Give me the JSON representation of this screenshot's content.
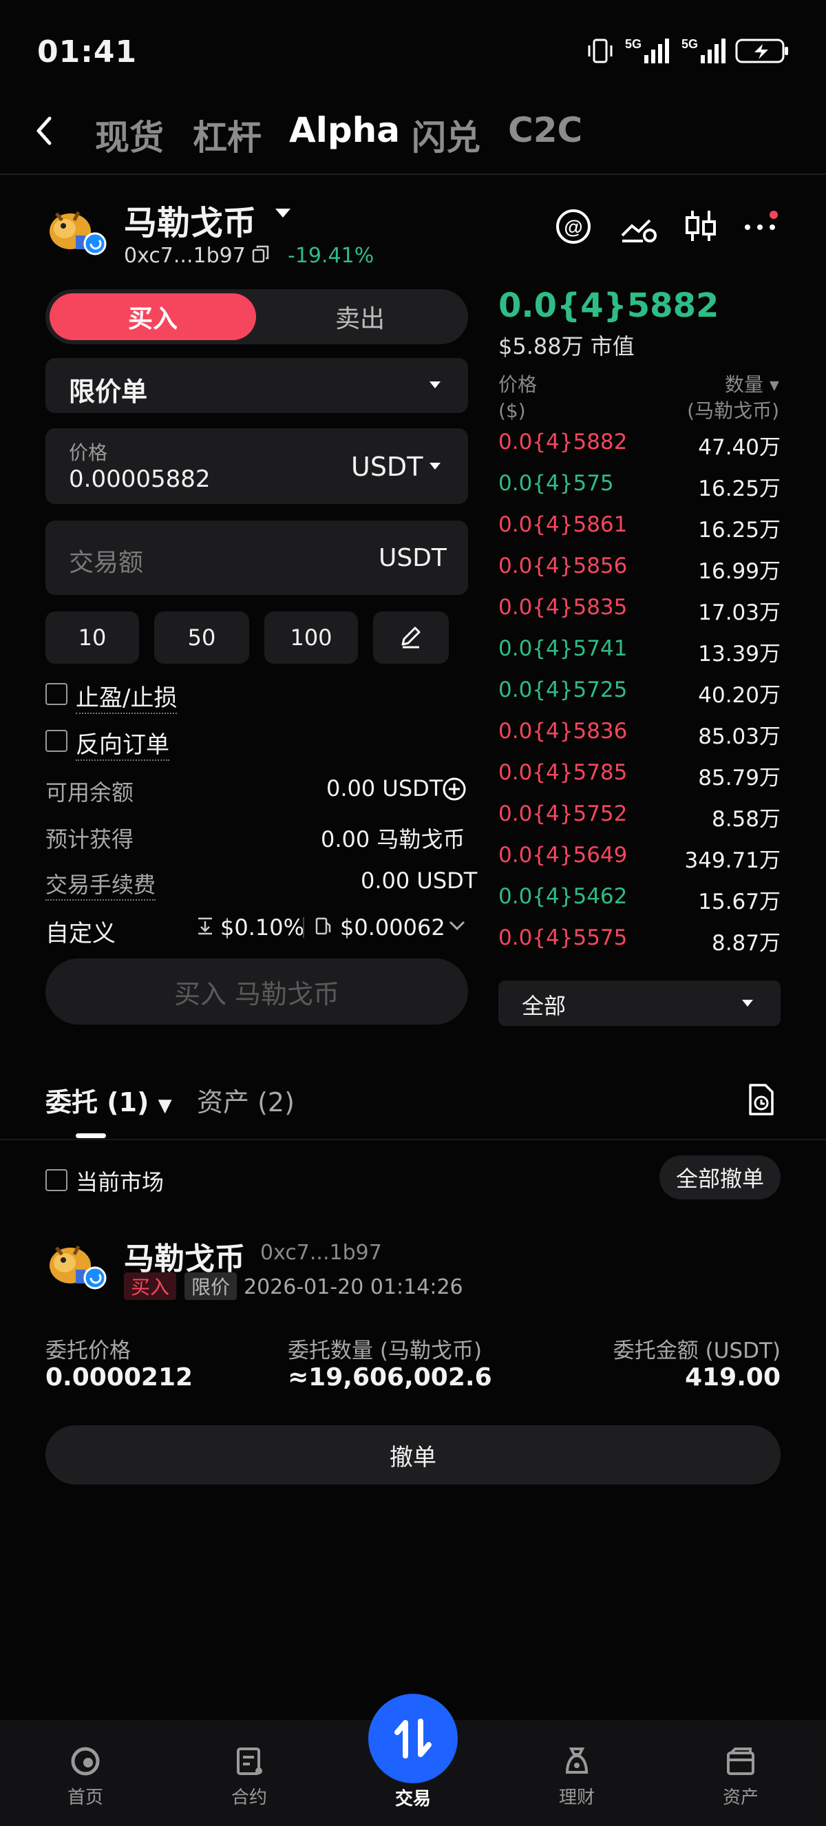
{
  "status_bar": {
    "time": "01:41",
    "net1": "5G",
    "net2": "5G"
  },
  "top_tabs": [
    "现货",
    "杠杆",
    "Alpha",
    "闪兑",
    "C2C"
  ],
  "token": {
    "name": "马勒戈币",
    "address": "0xc7...1b97",
    "change": "-19.41%"
  },
  "trade_form": {
    "buy_label": "买入",
    "sell_label": "卖出",
    "order_type": "限价单",
    "price_label": "价格",
    "price_value": "0.00005882",
    "price_unit": "USDT",
    "amount_placeholder": "交易额",
    "amount_unit": "USDT",
    "quick_amounts": [
      "10",
      "50",
      "100"
    ],
    "tp_sl_label": "止盈/止损",
    "reverse_label": "反向订单",
    "available_label": "可用余额",
    "available_value": "0.00 USDT",
    "estimate_label": "预计获得",
    "estimate_value": "0.00 马勒戈币",
    "fee_label": "交易手续费",
    "fee_value": "0.00 USDT",
    "custom_label": "自定义",
    "slippage": "$0.10%",
    "gas": "$0.00062",
    "submit_label": "买入 马勒戈币"
  },
  "order_book": {
    "last_price": "0.0{4}5882",
    "market_cap": "$5.88万 市值",
    "price_header": "价格",
    "price_unit_header": "($)",
    "qty_header": "数量",
    "qty_unit_header": "(马勒戈币)",
    "rows": [
      {
        "price": "0.0{4}5882",
        "qty": "47.40万",
        "side": "sell"
      },
      {
        "price": "0.0{4}575",
        "qty": "16.25万",
        "side": "buy"
      },
      {
        "price": "0.0{4}5861",
        "qty": "16.25万",
        "side": "sell"
      },
      {
        "price": "0.0{4}5856",
        "qty": "16.99万",
        "side": "sell"
      },
      {
        "price": "0.0{4}5835",
        "qty": "17.03万",
        "side": "sell"
      },
      {
        "price": "0.0{4}5741",
        "qty": "13.39万",
        "side": "buy"
      },
      {
        "price": "0.0{4}5725",
        "qty": "40.20万",
        "side": "buy"
      },
      {
        "price": "0.0{4}5836",
        "qty": "85.03万",
        "side": "sell"
      },
      {
        "price": "0.0{4}5785",
        "qty": "85.79万",
        "side": "sell"
      },
      {
        "price": "0.0{4}5752",
        "qty": "8.58万",
        "side": "sell"
      },
      {
        "price": "0.0{4}5649",
        "qty": "349.71万",
        "side": "sell"
      },
      {
        "price": "0.0{4}5462",
        "qty": "15.67万",
        "side": "buy"
      },
      {
        "price": "0.0{4}5575",
        "qty": "8.87万",
        "side": "sell"
      }
    ],
    "depth_select": "全部"
  },
  "orders_section": {
    "tab_orders": "委托 (1)",
    "tab_assets": "资产 (2)",
    "current_market": "当前市场",
    "cancel_all": "全部撤单",
    "order": {
      "name": "马勒戈币",
      "address": "0xc7...1b97",
      "side": "买入",
      "type": "限价",
      "time": "2026-01-20 01:14:26",
      "price_label": "委托价格",
      "price_value": "0.0000212",
      "qty_label": "委托数量 (马勒戈币)",
      "qty_value": "≈19,606,002.6",
      "total_label": "委托金额 (USDT)",
      "total_value": "419.00",
      "cancel_label": "撤单"
    }
  },
  "bottom_nav": [
    "首页",
    "合约",
    "交易",
    "理财",
    "资产"
  ],
  "colors": {
    "buy": "#2ebd85",
    "sell": "#f6465d",
    "accent": "#1e62ff"
  }
}
